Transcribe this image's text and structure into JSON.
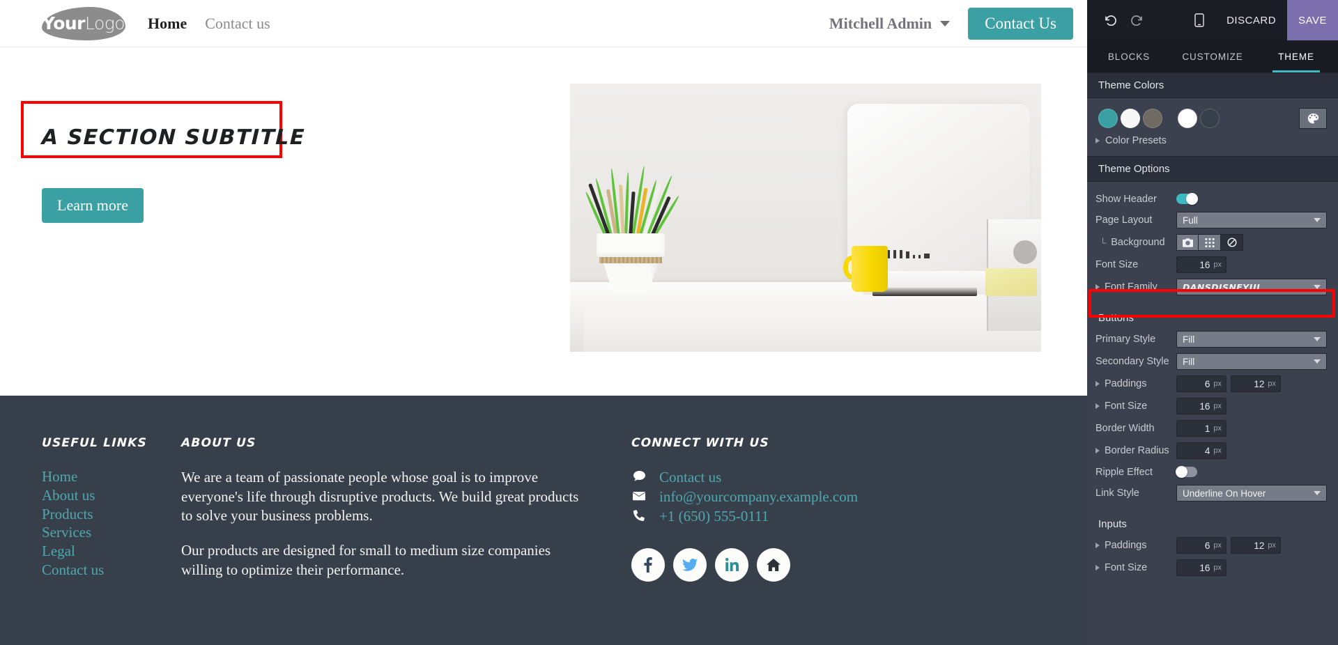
{
  "website": {
    "logo": {
      "part1": "Your",
      "part2": "Logo"
    },
    "nav": [
      {
        "label": "Home",
        "active": true
      },
      {
        "label": "Contact us",
        "active": false
      }
    ],
    "user": "Mitchell Admin",
    "header_cta": "Contact Us",
    "hero": {
      "subtitle": "A SECTION SUBTITLE",
      "cta": "Learn more"
    },
    "footer": {
      "columns": {
        "links": {
          "title": "USEFUL LINKS",
          "items": [
            "Home",
            "About us",
            "Products",
            "Services",
            "Legal",
            "Contact us"
          ]
        },
        "about": {
          "title": "ABOUT US",
          "paragraph1": "We are a team of passionate people whose goal is to improve everyone's life through disruptive products. We build great products to solve your business problems.",
          "paragraph2": "Our products are designed for small to medium size companies willing to optimize their performance."
        },
        "connect": {
          "title": "CONNECT WITH US",
          "contacts": [
            {
              "icon": "comment-icon",
              "glyph": "✉",
              "label": "Contact us"
            },
            {
              "icon": "envelope-icon",
              "glyph": "✉",
              "label": "info@yourcompany.example.com"
            },
            {
              "icon": "phone-icon",
              "glyph": "☎",
              "label": "+1 (650) 555-0111"
            }
          ],
          "socials": [
            {
              "name": "facebook-icon",
              "glyph": "f",
              "color": "#34495e"
            },
            {
              "name": "twitter-icon",
              "glyph": "ᴠ",
              "color": "#55acee"
            },
            {
              "name": "linkedin-icon",
              "glyph": "in",
              "color": "#2d8f96"
            },
            {
              "name": "home-icon",
              "glyph": "⌂",
              "color": "#2c3338"
            }
          ]
        }
      }
    }
  },
  "editor": {
    "toolbar": {
      "undo": "↺",
      "redo": "↻",
      "mobile_preview": "mobile-icon",
      "discard": "DISCARD",
      "save": "SAVE"
    },
    "tabs": [
      {
        "label": "BLOCKS",
        "active": false
      },
      {
        "label": "CUSTOMIZE",
        "active": false
      },
      {
        "label": "THEME",
        "active": true
      }
    ],
    "theme_colors": {
      "heading": "Theme Colors",
      "swatches": [
        "#3aa0a3",
        "#f7f7f7",
        "#6f6a62",
        "#ffffff",
        "#37404a"
      ],
      "palette_button": "palette-icon",
      "presets_label": "Color Presets"
    },
    "theme_options": {
      "heading": "Theme Options",
      "show_header": {
        "label": "Show Header",
        "value": "on"
      },
      "page_layout": {
        "label": "Page Layout",
        "value": "Full"
      },
      "background": {
        "label": "Background",
        "buttons": [
          "image-icon",
          "pattern-icon",
          "none-icon"
        ],
        "active": "none-icon"
      },
      "font_size": {
        "label": "Font Size",
        "value": "16",
        "unit": "px"
      },
      "font_family": {
        "label": "Font Family",
        "value": "DANSDISNEYUI"
      }
    },
    "buttons": {
      "heading": "Buttons",
      "primary_style": {
        "label": "Primary Style",
        "value": "Fill"
      },
      "secondary_style": {
        "label": "Secondary Style",
        "value": "Fill"
      },
      "paddings": {
        "label": "Paddings",
        "v1": "6",
        "u1": "px",
        "v2": "12",
        "u2": "px"
      },
      "font_size": {
        "label": "Font Size",
        "value": "16",
        "unit": "px"
      },
      "border_width": {
        "label": "Border Width",
        "value": "1",
        "unit": "px"
      },
      "border_radius": {
        "label": "Border Radius",
        "value": "4",
        "unit": "px"
      },
      "ripple_effect": {
        "label": "Ripple Effect",
        "value": "off"
      },
      "link_style": {
        "label": "Link Style",
        "value": "Underline On Hover"
      }
    },
    "inputs": {
      "heading": "Inputs",
      "paddings": {
        "label": "Paddings",
        "v1": "6",
        "u1": "px",
        "v2": "12",
        "u2": "px"
      },
      "font_size": {
        "label": "Font Size",
        "value": "16",
        "unit": "px"
      }
    }
  }
}
